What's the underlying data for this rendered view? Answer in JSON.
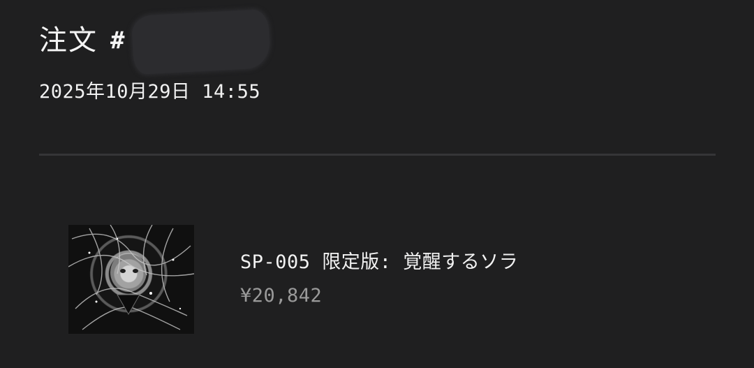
{
  "order": {
    "title": "注文",
    "hash": "#",
    "date": "2025年10月29日 14:55"
  },
  "item": {
    "name": "SP-005 限定版: 覚醒するソラ",
    "price": "¥20,842"
  },
  "colors": {
    "background": "#1f1f20",
    "text": "#f2f2f2",
    "muted_text": "#9a9a9a",
    "divider": "#353537"
  }
}
